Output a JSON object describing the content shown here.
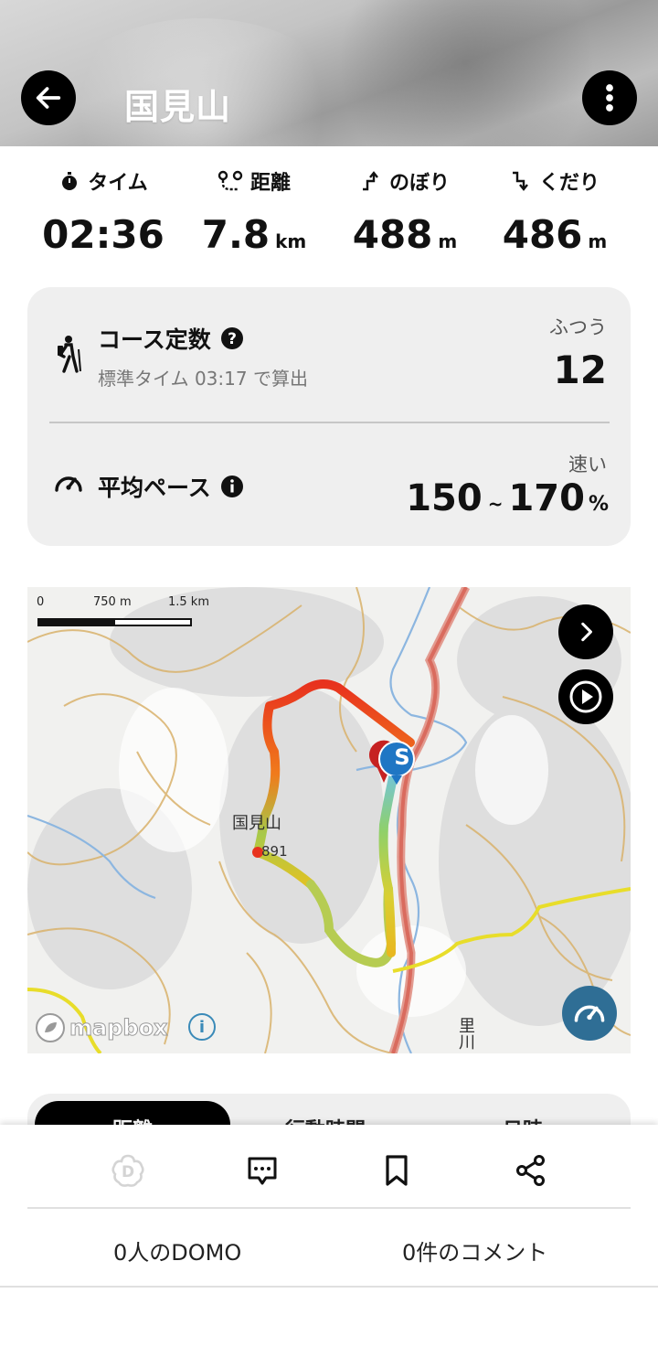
{
  "header": {
    "title": "国見山",
    "back_icon": "arrow-left-icon",
    "more_icon": "vertical-dots-icon"
  },
  "stats": [
    {
      "label": "タイム",
      "icon": "stopwatch-icon",
      "value": "02:36",
      "unit": ""
    },
    {
      "label": "距離",
      "icon": "route-pin-icon",
      "value": "7.8",
      "unit": "km"
    },
    {
      "label": "のぼり",
      "icon": "ascent-arrow-icon",
      "value": "488",
      "unit": "m"
    },
    {
      "label": "くだり",
      "icon": "descent-arrow-icon",
      "value": "486",
      "unit": "m"
    }
  ],
  "course": {
    "title": "コース定数",
    "help_icon": "question-circle-icon",
    "subtitle": "標準タイム 03:17 で算出",
    "grade": "ふつう",
    "value": "12"
  },
  "pace": {
    "title": "平均ペース",
    "info_icon": "info-circle-icon",
    "grade": "速い",
    "min": "150",
    "tilde": "~",
    "max": "170",
    "unit": "%"
  },
  "map": {
    "scale": {
      "zero": "0",
      "mid": "750 m",
      "max": "1.5 km"
    },
    "peak_label": "国見山",
    "peak_elev": "891",
    "river_label": "里川",
    "start_marker": "S",
    "logo_text": "mapbox",
    "colors": {
      "route_hot": "#e8321e",
      "route_cool": "#6fc3e8",
      "road": "#d96b5e",
      "contour": "#d9b26b",
      "yellow_road": "#e8dd2a",
      "river": "#8cb6e0"
    }
  },
  "tabs": {
    "items": [
      "距離",
      "行動時間",
      "日時"
    ]
  },
  "actions": {
    "domo_icon": "domo-flower-icon",
    "comment_icon": "comment-icon",
    "bookmark_icon": "bookmark-icon",
    "share_icon": "share-icon"
  },
  "counts": {
    "domo": "0人のDOMO",
    "comments": "0件のコメント"
  }
}
